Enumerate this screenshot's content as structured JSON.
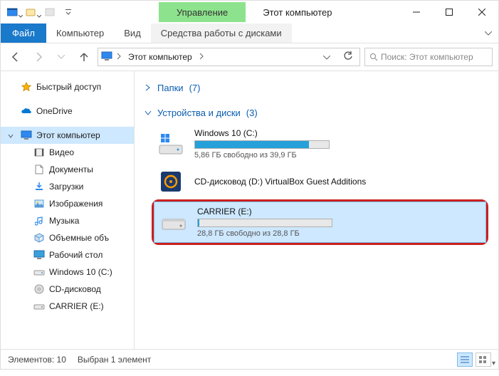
{
  "title_bar": {
    "ribbon_context_label": "Управление",
    "window_title": "Этот компьютер"
  },
  "tabs": {
    "file": "Файл",
    "computer": "Компьютер",
    "view": "Вид",
    "context": "Средства работы с дисками"
  },
  "address_bar": {
    "crumb_this_pc": "Этот компьютер"
  },
  "search": {
    "placeholder": "Поиск: Этот компьютер"
  },
  "nav_pane": {
    "quick_access": "Быстрый доступ",
    "onedrive": "OneDrive",
    "this_pc": "Этот компьютер",
    "video": "Видео",
    "documents": "Документы",
    "downloads": "Загрузки",
    "pictures": "Изображения",
    "music": "Музыка",
    "objects3d": "Объемные объ",
    "desktop": "Рабочий стол",
    "windows_c": "Windows 10 (C:)",
    "cd_drive": "CD-дисковод",
    "carrier": "CARRIER (E:)"
  },
  "groups": {
    "folders": {
      "label": "Папки",
      "count": "(7)"
    },
    "devices": {
      "label": "Устройства и диски",
      "count": "(3)"
    }
  },
  "drives": {
    "c": {
      "name": "Windows 10 (C:)",
      "sub": "5,86 ГБ свободно из 39,9 ГБ",
      "used_percent": 85
    },
    "d": {
      "name": "CD-дисковод (D:) VirtualBox Guest Additions",
      "sub": ""
    },
    "e": {
      "name": "CARRIER (E:)",
      "sub": "28,8 ГБ свободно из 28,8 ГБ",
      "used_percent": 1
    }
  },
  "status": {
    "count_label": "Элементов:",
    "count": "10",
    "selected_label": "Выбран 1 элемент"
  }
}
